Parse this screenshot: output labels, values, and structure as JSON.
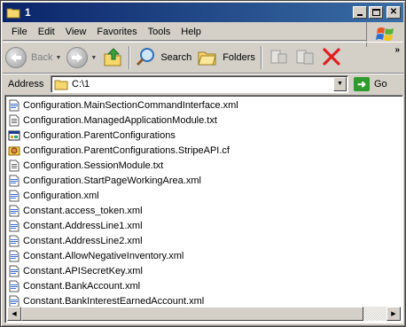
{
  "window": {
    "title": "1"
  },
  "menu": [
    "File",
    "Edit",
    "View",
    "Favorites",
    "Tools",
    "Help"
  ],
  "toolbar": {
    "back_label": "Back",
    "search_label": "Search",
    "folders_label": "Folders",
    "more_chevron": "»"
  },
  "address": {
    "label": "Address",
    "value": "C:\\1",
    "go_label": "Go"
  },
  "files": [
    {
      "name": "Configuration.MainSectionCommandInterface.xml",
      "icon": "xml-file-icon"
    },
    {
      "name": "Configuration.ManagedApplicationModule.txt",
      "icon": "text-file-icon"
    },
    {
      "name": "Configuration.ParentConfigurations",
      "icon": "generic-file-icon"
    },
    {
      "name": "Configuration.ParentConfigurations.StripeAPI.cf",
      "icon": "cf-file-icon"
    },
    {
      "name": "Configuration.SessionModule.txt",
      "icon": "text-file-icon"
    },
    {
      "name": "Configuration.StartPageWorkingArea.xml",
      "icon": "xml-file-icon"
    },
    {
      "name": "Configuration.xml",
      "icon": "xml-file-icon"
    },
    {
      "name": "Constant.access_token.xml",
      "icon": "xml-file-icon"
    },
    {
      "name": "Constant.AddressLine1.xml",
      "icon": "xml-file-icon"
    },
    {
      "name": "Constant.AddressLine2.xml",
      "icon": "xml-file-icon"
    },
    {
      "name": "Constant.AllowNegativeInventory.xml",
      "icon": "xml-file-icon"
    },
    {
      "name": "Constant.APISecretKey.xml",
      "icon": "xml-file-icon"
    },
    {
      "name": "Constant.BankAccount.xml",
      "icon": "xml-file-icon"
    },
    {
      "name": "Constant.BankInterestEarnedAccount.xml",
      "icon": "xml-file-icon"
    }
  ],
  "colors": {
    "titlebar": "#0a246a",
    "face": "#d4d0c8",
    "go": "#2e9b2e"
  }
}
